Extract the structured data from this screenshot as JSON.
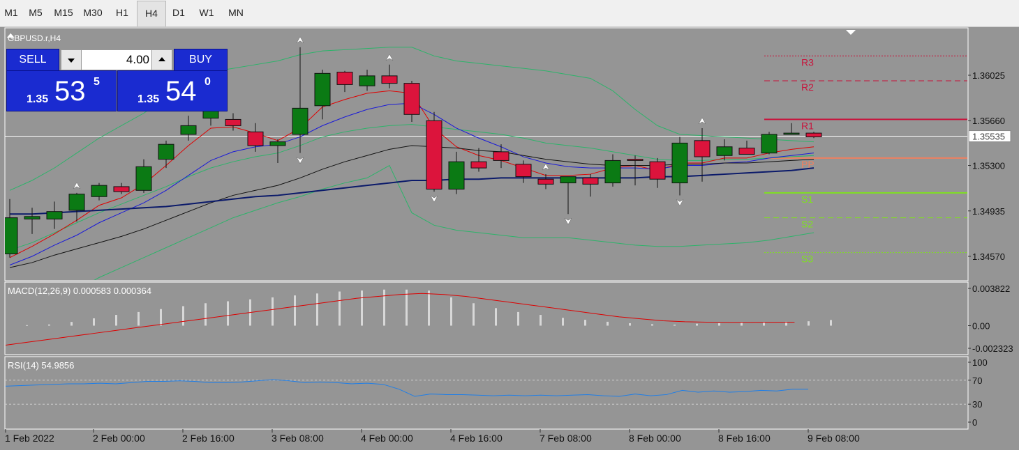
{
  "timeframes": [
    "M1",
    "M5",
    "M15",
    "M30",
    "H1",
    "H4",
    "D1",
    "W1",
    "MN"
  ],
  "active_timeframe": "H4",
  "symbol_label": "GBPUSD.r,H4",
  "trade_panel": {
    "sell_label": "SELL",
    "buy_label": "BUY",
    "lot_value": "4.00",
    "sell_price": {
      "prefix": "1.35",
      "big": "53",
      "sup": "5"
    },
    "buy_price": {
      "prefix": "1.35",
      "big": "54",
      "sup": "0"
    }
  },
  "colors": {
    "chart_bg": "#959595",
    "bull": "#0b7a14",
    "bear": "#dc143c",
    "ma_red": "#e00000",
    "ma_blue": "#1a1ad8",
    "ma_black": "#111111",
    "ma_navy": "#0b1a6a",
    "bollinger": "#2db36a",
    "pivot_resistance": "#c8143c",
    "pivot_pp": "#f08060",
    "pivot_support": "#7fe020",
    "macd_signal": "#dd0000",
    "rsi_line": "#1e7ee8"
  },
  "chart_data": [
    {
      "type": "candlestick",
      "title": "GBPUSD.r,H4",
      "x_labels": [
        "1 Feb 2022",
        "2 Feb 00:00",
        "2 Feb 16:00",
        "3 Feb 08:00",
        "4 Feb 00:00",
        "4 Feb 16:00",
        "7 Feb 08:00",
        "8 Feb 00:00",
        "8 Feb 16:00",
        "9 Feb 08:00"
      ],
      "y_ticks": [
        "1.36025",
        "1.35660",
        "1.35300",
        "1.34935",
        "1.34570"
      ],
      "current_price": "1.35535",
      "ylim": [
        1.344,
        1.3628
      ],
      "candles": [
        {
          "o": 1.3459,
          "h": 1.3503,
          "l": 1.3456,
          "c": 1.3488
        },
        {
          "o": 1.3487,
          "h": 1.3496,
          "l": 1.3475,
          "c": 1.3489
        },
        {
          "o": 1.3487,
          "h": 1.3501,
          "l": 1.3479,
          "c": 1.3493
        },
        {
          "o": 1.3494,
          "h": 1.3508,
          "l": 1.3485,
          "c": 1.3507
        },
        {
          "o": 1.3505,
          "h": 1.3516,
          "l": 1.3502,
          "c": 1.3514
        },
        {
          "o": 1.3513,
          "h": 1.3516,
          "l": 1.3507,
          "c": 1.3509
        },
        {
          "o": 1.351,
          "h": 1.3535,
          "l": 1.3508,
          "c": 1.3529
        },
        {
          "o": 1.3535,
          "h": 1.355,
          "l": 1.3528,
          "c": 1.3547
        },
        {
          "o": 1.3555,
          "h": 1.357,
          "l": 1.355,
          "c": 1.3562
        },
        {
          "o": 1.3568,
          "h": 1.3587,
          "l": 1.3562,
          "c": 1.3584
        },
        {
          "o": 1.3567,
          "h": 1.3572,
          "l": 1.3558,
          "c": 1.3562
        },
        {
          "o": 1.3557,
          "h": 1.3564,
          "l": 1.3541,
          "c": 1.3546
        },
        {
          "o": 1.3546,
          "h": 1.3551,
          "l": 1.3532,
          "c": 1.3549
        },
        {
          "o": 1.3555,
          "h": 1.3625,
          "l": 1.354,
          "c": 1.3576
        },
        {
          "o": 1.3578,
          "h": 1.3607,
          "l": 1.3567,
          "c": 1.3604
        },
        {
          "o": 1.3605,
          "h": 1.3606,
          "l": 1.3589,
          "c": 1.3595
        },
        {
          "o": 1.3594,
          "h": 1.3607,
          "l": 1.359,
          "c": 1.3602
        },
        {
          "o": 1.3602,
          "h": 1.3611,
          "l": 1.3592,
          "c": 1.3596
        },
        {
          "o": 1.3596,
          "h": 1.3598,
          "l": 1.3565,
          "c": 1.3571
        },
        {
          "o": 1.3566,
          "h": 1.3573,
          "l": 1.3509,
          "c": 1.3511
        },
        {
          "o": 1.3511,
          "h": 1.3541,
          "l": 1.3507,
          "c": 1.3533
        },
        {
          "o": 1.3533,
          "h": 1.3544,
          "l": 1.3525,
          "c": 1.3528
        },
        {
          "o": 1.3541,
          "h": 1.3547,
          "l": 1.3528,
          "c": 1.3534
        },
        {
          "o": 1.3531,
          "h": 1.3534,
          "l": 1.3516,
          "c": 1.3521
        },
        {
          "o": 1.3519,
          "h": 1.3523,
          "l": 1.3511,
          "c": 1.3515
        },
        {
          "o": 1.3516,
          "h": 1.3521,
          "l": 1.3491,
          "c": 1.3521
        },
        {
          "o": 1.352,
          "h": 1.3523,
          "l": 1.3505,
          "c": 1.3515
        },
        {
          "o": 1.3516,
          "h": 1.3539,
          "l": 1.3513,
          "c": 1.3534
        },
        {
          "o": 1.3535,
          "h": 1.3538,
          "l": 1.3514,
          "c": 1.3534
        },
        {
          "o": 1.3533,
          "h": 1.3536,
          "l": 1.3512,
          "c": 1.3519
        },
        {
          "o": 1.3516,
          "h": 1.3553,
          "l": 1.3506,
          "c": 1.3548
        },
        {
          "o": 1.355,
          "h": 1.356,
          "l": 1.3517,
          "c": 1.3537
        },
        {
          "o": 1.3538,
          "h": 1.3551,
          "l": 1.3534,
          "c": 1.3545
        },
        {
          "o": 1.3544,
          "h": 1.355,
          "l": 1.354,
          "c": 1.3539
        },
        {
          "o": 1.354,
          "h": 1.3557,
          "l": 1.3539,
          "c": 1.3555
        },
        {
          "o": 1.3555,
          "h": 1.3564,
          "l": 1.3555,
          "c": 1.3556
        },
        {
          "o": 1.3556,
          "h": 1.3557,
          "l": 1.3552,
          "c": 1.3553
        }
      ],
      "fractals_up": [
        3,
        13,
        17,
        24,
        31
      ],
      "fractals_down": [
        13,
        19,
        25,
        30
      ],
      "moving_averages": [
        {
          "color_key": "ma_red",
          "values": [
            1.3456,
            1.3465,
            1.3475,
            1.3486,
            1.3498,
            1.3504,
            1.3515,
            1.353,
            1.3546,
            1.356,
            1.3561,
            1.3556,
            1.355,
            1.356,
            1.3577,
            1.3583,
            1.3588,
            1.359,
            1.3588,
            1.356,
            1.3545,
            1.3538,
            1.3534,
            1.3528,
            1.3522,
            1.3522,
            1.3523,
            1.3528,
            1.353,
            1.3526,
            1.3532,
            1.3532,
            1.3536,
            1.3536,
            1.354,
            1.3543,
            1.3545
          ]
        },
        {
          "color_key": "ma_blue",
          "values": [
            1.345,
            1.3457,
            1.3466,
            1.3474,
            1.3484,
            1.3492,
            1.35,
            1.351,
            1.3522,
            1.3534,
            1.3541,
            1.3545,
            1.3547,
            1.3553,
            1.3562,
            1.3569,
            1.3575,
            1.3579,
            1.358,
            1.3571,
            1.356,
            1.3552,
            1.3545,
            1.3537,
            1.3532,
            1.3529,
            1.3528,
            1.3528,
            1.3528,
            1.3527,
            1.353,
            1.353,
            1.3532,
            1.3533,
            1.3536,
            1.3538,
            1.354
          ]
        },
        {
          "color_key": "ma_black",
          "values": [
            1.3448,
            1.3452,
            1.3458,
            1.3463,
            1.3468,
            1.3473,
            1.3479,
            1.3486,
            1.3493,
            1.35,
            1.3506,
            1.351,
            1.3514,
            1.352,
            1.3527,
            1.3533,
            1.3538,
            1.3543,
            1.3546,
            1.3545,
            1.3544,
            1.3542,
            1.3541,
            1.3538,
            1.3535,
            1.3533,
            1.3531,
            1.353,
            1.353,
            1.353,
            1.3531,
            1.3531,
            1.3532,
            1.3532,
            1.3533,
            1.3534,
            1.3535
          ]
        },
        {
          "color_key": "ma_navy",
          "values": [
            1.3491,
            1.3491,
            1.3492,
            1.3493,
            1.3494,
            1.3495,
            1.3496,
            1.3497,
            1.3499,
            1.3501,
            1.3503,
            1.3505,
            1.3506,
            1.3508,
            1.351,
            1.3512,
            1.3514,
            1.3516,
            1.3518,
            1.3518,
            1.3519,
            1.3519,
            1.352,
            1.352,
            1.352,
            1.352,
            1.352,
            1.352,
            1.352,
            1.3521,
            1.3521,
            1.3522,
            1.3523,
            1.3524,
            1.3525,
            1.3526,
            1.3528
          ]
        }
      ],
      "bollinger": {
        "upper": [
          1.351,
          1.3518,
          1.3528,
          1.354,
          1.3552,
          1.3562,
          1.3572,
          1.3584,
          1.3596,
          1.3605,
          1.3608,
          1.3611,
          1.3614,
          1.3619,
          1.3622,
          1.3623,
          1.3624,
          1.3625,
          1.3625,
          1.3618,
          1.3614,
          1.3612,
          1.361,
          1.3608,
          1.3606,
          1.3603,
          1.36,
          1.359,
          1.3575,
          1.3562,
          1.3555,
          1.3554,
          1.3553,
          1.3552,
          1.3551,
          1.355,
          1.3549
        ]
      },
      "bollinger_mid": [
        1.3462,
        1.3468,
        1.3476,
        1.3484,
        1.3492,
        1.3499,
        1.3506,
        1.3513,
        1.3521,
        1.3528,
        1.3533,
        1.3537,
        1.354,
        1.3546,
        1.3553,
        1.3557,
        1.356,
        1.3562,
        1.3563,
        1.3561,
        1.3559,
        1.3557,
        1.3555,
        1.3552,
        1.3548,
        1.3546,
        1.3544,
        1.3541,
        1.3538,
        1.3535,
        1.3534,
        1.3534,
        1.3535,
        1.3535,
        1.3536,
        1.3537,
        1.3538
      ],
      "bollinger_lower": [
        1.34,
        1.341,
        1.342,
        1.343,
        1.344,
        1.3448,
        1.3456,
        1.3464,
        1.3472,
        1.348,
        1.3488,
        1.3494,
        1.35,
        1.3505,
        1.3511,
        1.3516,
        1.352,
        1.353,
        1.3492,
        1.3482,
        1.3478,
        1.3476,
        1.3474,
        1.3472,
        1.3472,
        1.3472,
        1.347,
        1.3468,
        1.3466,
        1.3465,
        1.3465,
        1.3466,
        1.3467,
        1.3468,
        1.347,
        1.3473,
        1.3476
      ],
      "pivots": [
        {
          "label": "R3",
          "value": 1.3618,
          "style": "dotted",
          "color_key": "pivot_resistance"
        },
        {
          "label": "R2",
          "value": 1.3598,
          "style": "dashed",
          "color_key": "pivot_resistance"
        },
        {
          "label": "R1",
          "value": 1.3567,
          "style": "solid",
          "color_key": "pivot_resistance"
        },
        {
          "label": "PP",
          "value": 1.3536,
          "style": "solid",
          "color_key": "pivot_pp"
        },
        {
          "label": "S1",
          "value": 1.3508,
          "style": "solid",
          "color_key": "pivot_support"
        },
        {
          "label": "S2",
          "value": 1.3488,
          "style": "dashed",
          "color_key": "pivot_support"
        },
        {
          "label": "S3",
          "value": 1.346,
          "style": "dotted",
          "color_key": "pivot_support"
        }
      ]
    },
    {
      "type": "bar",
      "title": "MACD(12,26,9) 0.000583 0.000364",
      "y_ticks": [
        "0.003822",
        "0.00",
        "-0.002323"
      ],
      "ylim": [
        -0.002323,
        0.003822
      ],
      "histogram": [
        5e-05,
        0.00012,
        0.00038,
        0.00075,
        0.0011,
        0.0014,
        0.0017,
        0.002,
        0.0023,
        0.0025,
        0.0027,
        0.0029,
        0.0031,
        0.0033,
        0.0035,
        0.0036,
        0.0037,
        0.0037,
        0.0036,
        0.0029,
        0.0023,
        0.0018,
        0.0014,
        0.0011,
        0.0008,
        0.0006,
        0.0004,
        0.00025,
        0.00015,
        0.0001,
        0.0002,
        0.00025,
        0.0003,
        0.00035,
        0.0004,
        0.00045,
        0.00058
      ],
      "signal": [
        -0.002,
        -0.0017,
        -0.0014,
        -0.0011,
        -0.0008,
        -0.0005,
        -0.0002,
        0.0001,
        0.0004,
        0.0007,
        0.001,
        0.0013,
        0.0016,
        0.0019,
        0.0022,
        0.0025,
        0.0028,
        0.003,
        0.0032,
        0.0033,
        0.0032,
        0.003,
        0.0027,
        0.0024,
        0.0021,
        0.0018,
        0.0015,
        0.0012,
        0.0009,
        0.0007,
        0.0005,
        0.0004,
        0.00036,
        0.00034,
        0.00034,
        0.00035,
        0.00036
      ]
    },
    {
      "type": "line",
      "title": "RSI(14) 54.9856",
      "y_ticks": [
        "100",
        "70",
        "30",
        "0"
      ],
      "ylim": [
        0,
        100
      ],
      "levels": [
        70,
        30
      ],
      "values": [
        60,
        61,
        62,
        63,
        64,
        64,
        65,
        64,
        66,
        68,
        68,
        69,
        68,
        66,
        66,
        67,
        69,
        71,
        69,
        66,
        67,
        66,
        64,
        65,
        63,
        55,
        43,
        47,
        46,
        46,
        45,
        44,
        45,
        44,
        45,
        44,
        45,
        46,
        44,
        43,
        47,
        44,
        46,
        53,
        50,
        52,
        50,
        51,
        53,
        52,
        55,
        55
      ]
    }
  ]
}
